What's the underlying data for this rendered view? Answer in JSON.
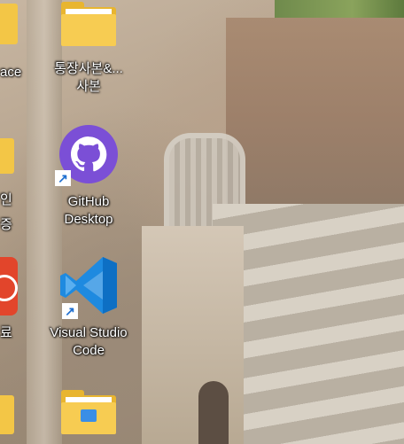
{
  "desktop": {
    "icons": [
      {
        "id": "bankbook",
        "label": "통장사본&...\n사본",
        "type": "folder"
      },
      {
        "id": "github",
        "label": "GitHub\nDesktop",
        "type": "shortcut"
      },
      {
        "id": "vscode",
        "label": "Visual Studio\nCode",
        "type": "shortcut"
      },
      {
        "id": "folder-bottom",
        "label": "",
        "type": "folder"
      }
    ],
    "left_partial": {
      "label_1": "ace",
      "label_2": "인",
      "label_3": "증",
      "label_4": "료"
    }
  },
  "colors": {
    "github_purple": "#7b4fd6",
    "vscode_blue": "#1e8ae0",
    "folder_yellow": "#f7cc52",
    "red_app": "#e2452b"
  }
}
